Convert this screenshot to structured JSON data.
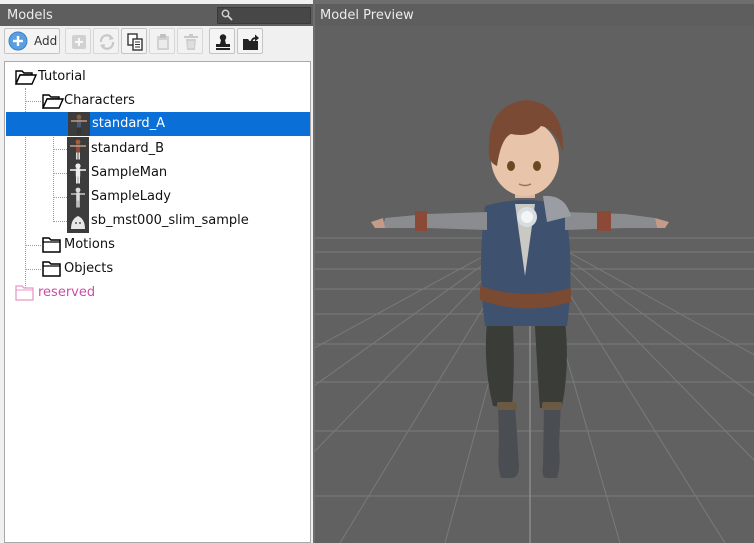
{
  "models_panel": {
    "title": "Models",
    "search_placeholder": ""
  },
  "toolbar": {
    "add_label": "Add",
    "buttons": [
      "add-icon",
      "new-item-icon",
      "refresh-icon",
      "copy-icon",
      "paste-icon",
      "delete-icon",
      "stamp-icon",
      "export-icon"
    ]
  },
  "tree": {
    "root": "Tutorial",
    "characters_folder": "Characters",
    "characters": [
      "standard_A",
      "standard_B",
      "SampleMan",
      "SampleLady",
      "sb_mst000_slim_sample"
    ],
    "selected": "standard_A",
    "motions_folder": "Motions",
    "objects_folder": "Objects",
    "reserved": "reserved"
  },
  "preview": {
    "title": "Model Preview"
  },
  "colors": {
    "selection": "#0a6fd6",
    "reserved": "#c94fa4",
    "header_bg": "#5e5e5e",
    "viewport_bg": "#616161"
  }
}
